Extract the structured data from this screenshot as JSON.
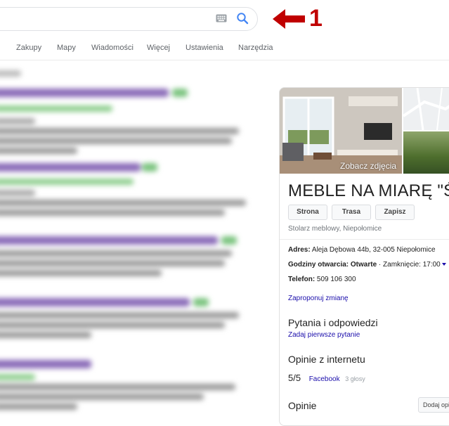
{
  "annotation": {
    "number": "1",
    "color": "#c00000"
  },
  "tabs": [
    "Zakupy",
    "Mapy",
    "Wiadomości",
    "Więcej",
    "Ustawienia",
    "Narzędzia"
  ],
  "knowledge_panel": {
    "photo_label": "Zobacz zdjęcia",
    "title": "MEBLE NA MIARĘ \"ŚL",
    "buttons": [
      "Strona",
      "Trasa",
      "Zapisz"
    ],
    "subtitle": "Stolarz meblowy, Niepołomice",
    "address_label": "Adres:",
    "address_value": " Aleja Dębowa 44b, 32-005 Niepołomice",
    "hours_label": "Godziny otwarcia:",
    "hours_status": " Otwarte",
    "hours_close": " · Zamknięcie: 17:00",
    "phone_label": "Telefon:",
    "phone_value": " 509 106 300",
    "suggest_edit": "Zaproponuj zmianę",
    "qa_heading": "Pytania i odpowiedzi",
    "qa_link": "Zadaj pierwsze pytanie",
    "web_reviews_heading": "Opinie z internetu",
    "web_rating": "5/5",
    "web_source": "Facebook",
    "web_votes": "3 głosy",
    "reviews_heading": "Opinie",
    "add_review_button": "Dodaj opi"
  }
}
